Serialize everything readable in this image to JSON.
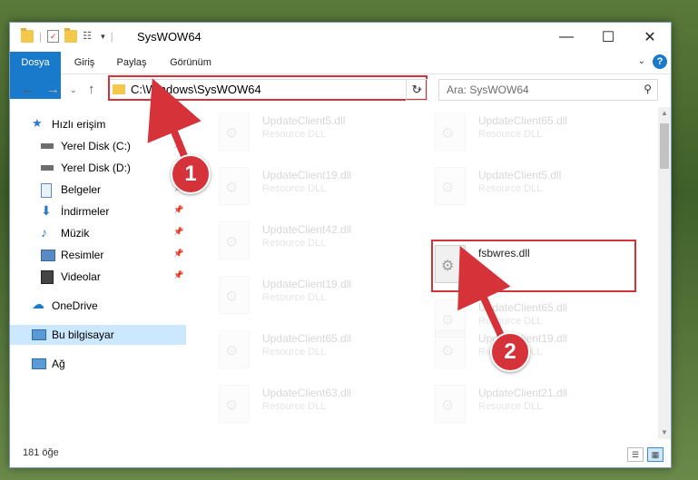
{
  "window": {
    "title": "SysWOW64"
  },
  "ribbon": {
    "tabs": [
      "Dosya",
      "Giriş",
      "Paylaş",
      "Görünüm"
    ],
    "help": "?"
  },
  "nav": {
    "address": "C:\\Windows\\SysWOW64",
    "search_placeholder": "Ara: SysWOW64"
  },
  "sidebar": {
    "items": [
      {
        "label": "Hızlı erişim",
        "icon": "star-icon"
      },
      {
        "label": "Yerel Disk (C:)",
        "icon": "drive-icon"
      },
      {
        "label": "Yerel Disk (D:)",
        "icon": "drive-icon"
      },
      {
        "label": "Belgeler",
        "icon": "documents-icon"
      },
      {
        "label": "İndirmeler",
        "icon": "download-icon"
      },
      {
        "label": "Müzik",
        "icon": "music-icon"
      },
      {
        "label": "Resimler",
        "icon": "pictures-icon"
      },
      {
        "label": "Videolar",
        "icon": "video-icon"
      },
      {
        "label": "OneDrive",
        "icon": "cloud-icon"
      },
      {
        "label": "Bu bilgisayar",
        "icon": "computer-icon"
      },
      {
        "label": "Ağ",
        "icon": "network-icon"
      }
    ]
  },
  "files": [
    {
      "name": "UpdateClient5.dll",
      "type": "Resource DLL"
    },
    {
      "name": "UpdateClient65.dll",
      "type": "Resource DLL"
    },
    {
      "name": "UpdateClient19.dll",
      "type": "Resource DLL"
    },
    {
      "name": "UpdateClient5.dll",
      "type": "Resource DLL"
    },
    {
      "name": "UpdateClient42.dll",
      "type": "Resource DLL"
    },
    {
      "name": "fsbwres.dll",
      "type": ""
    },
    {
      "name": "UpdateClient19.dll",
      "type": "Resource DLL"
    },
    {
      "name": "UpdateClient65.dll",
      "type": "Resource DLL"
    },
    {
      "name": "UpdateClient65.dll",
      "type": "Resource DLL"
    },
    {
      "name": "UpdateClient19.dll",
      "type": "Resource DLL"
    },
    {
      "name": "UpdateClient63.dll",
      "type": "Resource DLL"
    },
    {
      "name": "UpdateClient21.dll",
      "type": "Resource DLL"
    }
  ],
  "status": {
    "count": "181 öğe"
  },
  "annotations": {
    "step1": "1",
    "step2": "2",
    "color": "#d6323a"
  }
}
